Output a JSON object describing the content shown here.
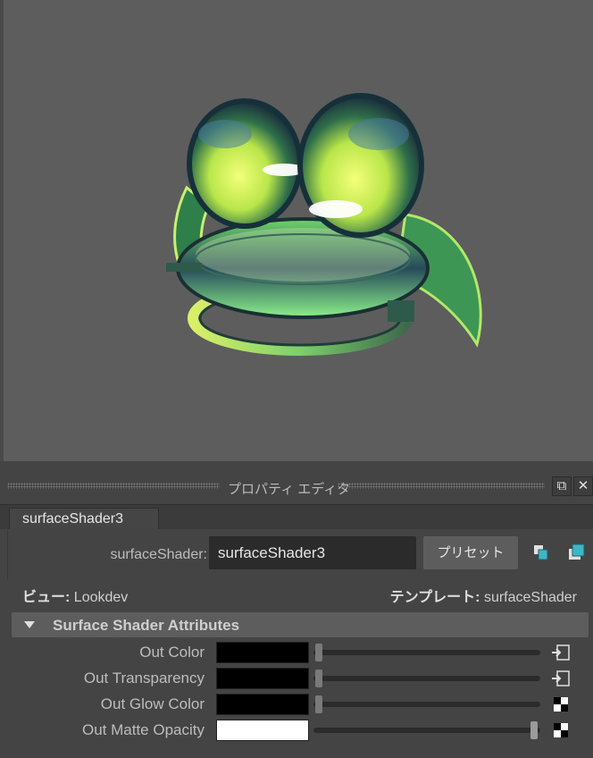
{
  "panel": {
    "title": "プロパティ エディタ",
    "tab_label": "surfaceShader3"
  },
  "node": {
    "type_label": "surfaceShader:",
    "name_value": "surfaceShader3",
    "preset_label": "プリセット"
  },
  "view": {
    "view_key": "ビュー:",
    "view_value": "Lookdev",
    "template_key": "テンプレート:",
    "template_value": "surfaceShader"
  },
  "section": {
    "title": "Surface Shader Attributes"
  },
  "attributes": [
    {
      "label": "Out Color",
      "swatch": "#000000",
      "slider": 0.0,
      "map_icon": "connection-input-icon"
    },
    {
      "label": "Out Transparency",
      "swatch": "#000000",
      "slider": 0.0,
      "map_icon": "connection-input-icon"
    },
    {
      "label": "Out Glow Color",
      "swatch": "#000000",
      "slider": 0.0,
      "map_icon": "checker-map-icon"
    },
    {
      "label": "Out Matte Opacity",
      "swatch": "#ffffff",
      "slider": 1.0,
      "map_icon": "checker-map-icon"
    }
  ],
  "colors": {
    "viewport_bg": "#5d5d5d",
    "panel_bg": "#444444",
    "accent_teal": "#3fb6c4"
  }
}
